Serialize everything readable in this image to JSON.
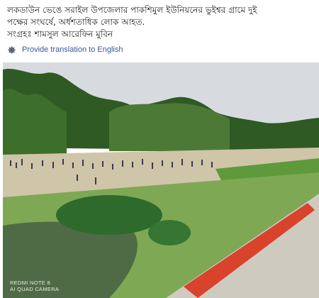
{
  "post": {
    "text_line1": "লকডাউন ভেঙে সরাইল উপজেলার পাকশিমুল ইউনিয়নের ভুইশ্বর গ্রামে দুই",
    "text_line2": "পক্ষের সংঘর্ষে, অর্ধশতাধিক লোক আহত.",
    "credit": "সংগ্রহঃ শামসুল আরেফিন মুবিন"
  },
  "translate": {
    "label": "Provide translation to English",
    "icon": "gear-icon"
  },
  "photo": {
    "watermark_line1": "REDMI NOTE 8",
    "watermark_line2": "AI QUAD CAMERA"
  },
  "colors": {
    "link": "#385898",
    "text": "#1c1e21"
  }
}
